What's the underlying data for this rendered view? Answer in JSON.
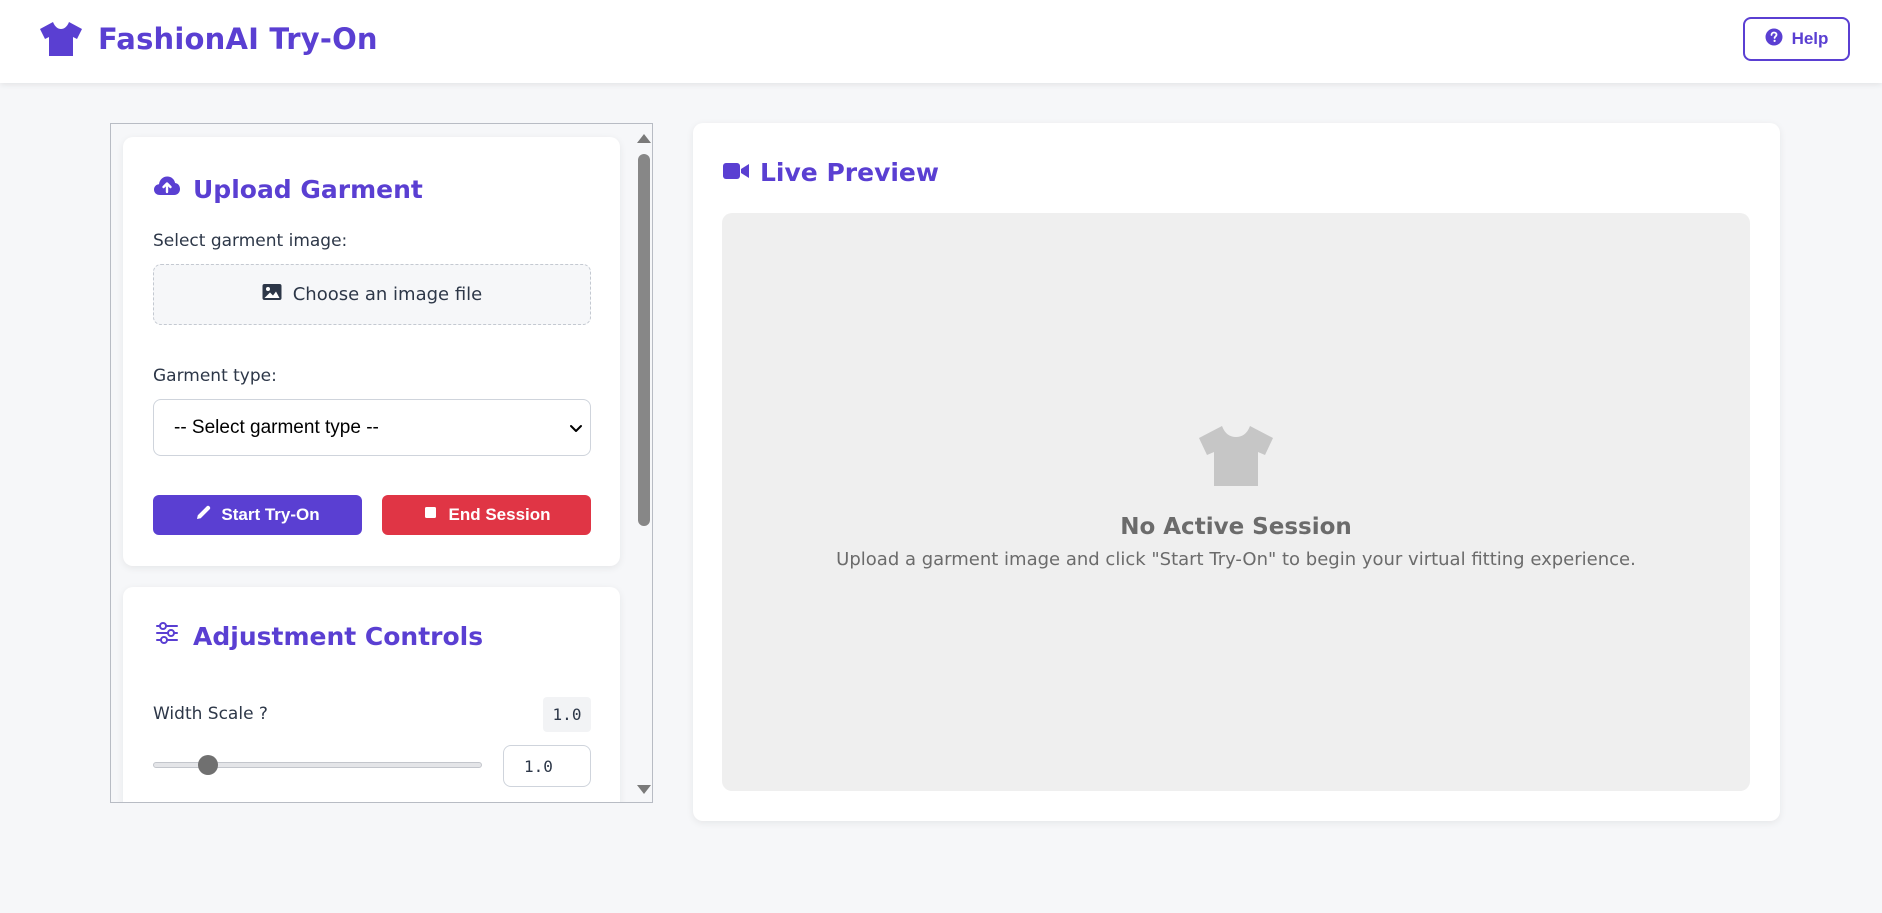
{
  "header": {
    "logo_icon": "tshirt-icon",
    "title": "FashionAI Try-On",
    "help_label": "Help",
    "help_icon": "question-circle-icon"
  },
  "colors": {
    "brand": "#5a3fd2",
    "danger": "#e03545",
    "background": "#f6f7f9"
  },
  "upload": {
    "icon": "cloud-upload-icon",
    "title": "Upload Garment",
    "image_label": "Select garment image:",
    "file_button_icon": "image-icon",
    "file_button_label": "Choose an image file",
    "type_label": "Garment type:",
    "type_selected": "-- Select garment type --",
    "start_icon": "pencil-icon",
    "start_label": "Start Try-On",
    "end_icon": "stop-icon",
    "end_label": "End Session"
  },
  "adjust": {
    "icon": "sliders-icon",
    "title": "Adjustment Controls",
    "width_scale": {
      "label": "Width Scale ?",
      "value_display": "1.0",
      "input_value": "1.0"
    }
  },
  "preview": {
    "icon": "video-camera-icon",
    "title": "Live Preview",
    "empty_icon": "tshirt-icon",
    "empty_title": "No Active Session",
    "empty_text": "Upload a garment image and click \"Start Try-On\" to begin your virtual fitting experience."
  }
}
